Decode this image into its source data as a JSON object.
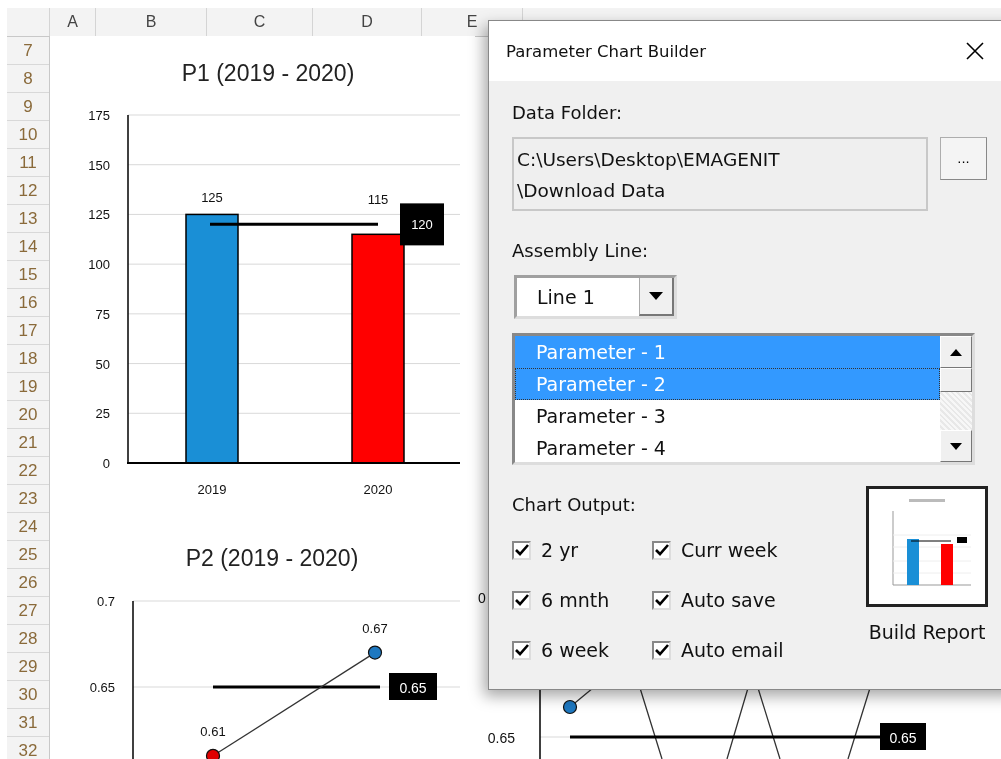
{
  "sheet": {
    "columns": [
      "A",
      "B",
      "C",
      "D",
      "E"
    ],
    "rows": [
      "7",
      "8",
      "9",
      "10",
      "11",
      "12",
      "13",
      "14",
      "15",
      "16",
      "17",
      "18",
      "19",
      "20",
      "21",
      "22",
      "23",
      "24",
      "25",
      "26",
      "27",
      "28",
      "29",
      "30",
      "31",
      "32"
    ]
  },
  "charts": [
    {
      "title": "P1 (2019 - 2020)",
      "chart_data": {
        "type": "bar",
        "categories": [
          "2019",
          "2020"
        ],
        "values": [
          125,
          115
        ],
        "colors": [
          "#1a8fd6",
          "#ff0000"
        ],
        "ylim": [
          0,
          175
        ],
        "yticks": [
          0,
          25,
          50,
          75,
          100,
          125,
          150,
          175
        ],
        "grid": true,
        "data_labels": true,
        "ref_lines": [
          {
            "axis": "y",
            "value": 120,
            "label": "120"
          }
        ]
      }
    },
    {
      "title": "P2 (2019 - 2020)",
      "chart_data": {
        "type": "line",
        "values": [
          0.61,
          0.67
        ],
        "colors": [
          "#e00000",
          "#1e78c0"
        ],
        "ylim": [
          0.608,
          0.7
        ],
        "yticks": [
          0.65,
          0.7
        ],
        "grid": true,
        "marker": "o",
        "data_labels": true,
        "ref_lines": [
          {
            "axis": "y",
            "value": 0.65,
            "label": "0.65"
          }
        ]
      }
    }
  ],
  "partial_chart": {
    "top_tick": "0",
    "tick": "0.65",
    "target_label": "0.65"
  },
  "dialog": {
    "title": "Parameter Chart Builder",
    "data_folder": {
      "label": "Data Folder:",
      "value": "C:\\Users\\Desktop\\EMAGENIT\n\\Download Data",
      "browse": "..."
    },
    "assembly_line": {
      "label": "Assembly Line:",
      "value": "Line 1"
    },
    "parameters": [
      {
        "label": "Parameter - 1",
        "selected": true,
        "focused": false
      },
      {
        "label": "Parameter - 2",
        "selected": true,
        "focused": true
      },
      {
        "label": "Parameter - 3",
        "selected": false,
        "focused": false
      },
      {
        "label": "Parameter - 4",
        "selected": false,
        "focused": false
      }
    ],
    "chart_output": {
      "label": "Chart Output:",
      "options": [
        {
          "label": "2 yr",
          "checked": true
        },
        {
          "label": "6 mnth",
          "checked": true
        },
        {
          "label": "6 week",
          "checked": true
        },
        {
          "label": "Curr week",
          "checked": true
        },
        {
          "label": "Auto save",
          "checked": true
        },
        {
          "label": "Auto email",
          "checked": true
        }
      ]
    },
    "build_button": {
      "label": "Build Report"
    }
  }
}
